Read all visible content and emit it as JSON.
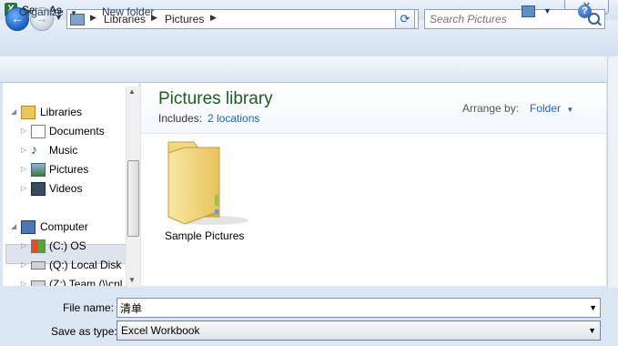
{
  "window": {
    "title": "Save As",
    "close_label": "✕"
  },
  "address": {
    "crumbs": [
      "Libraries",
      "Pictures"
    ],
    "search_placeholder": "Search Pictures"
  },
  "toolbar": {
    "organize": "Organize",
    "new_folder": "New folder"
  },
  "nav": {
    "libraries": "Libraries",
    "documents": "Documents",
    "music": "Music",
    "pictures": "Pictures",
    "videos": "Videos",
    "computer": "Computer",
    "drive_c": "(C:) OS",
    "drive_q": "(Q:) Local Disk",
    "drive_z": "(Z:) Team (\\\\cnl"
  },
  "content": {
    "title": "Pictures library",
    "includes_label": "Includes:",
    "locations_link": "2 locations",
    "arrange_label": "Arrange by:",
    "arrange_value": "Folder",
    "items": [
      "Sample Pictures"
    ]
  },
  "form": {
    "file_name_label": "File name:",
    "file_name_value": "清单",
    "save_type_label": "Save as type:",
    "save_type_value": "Excel Workbook"
  },
  "icons": {
    "app": "excel-icon",
    "back": "back-arrow-icon",
    "forward": "forward-arrow-icon",
    "search": "search-icon",
    "help": "help-icon",
    "folder": "folder-icon"
  }
}
